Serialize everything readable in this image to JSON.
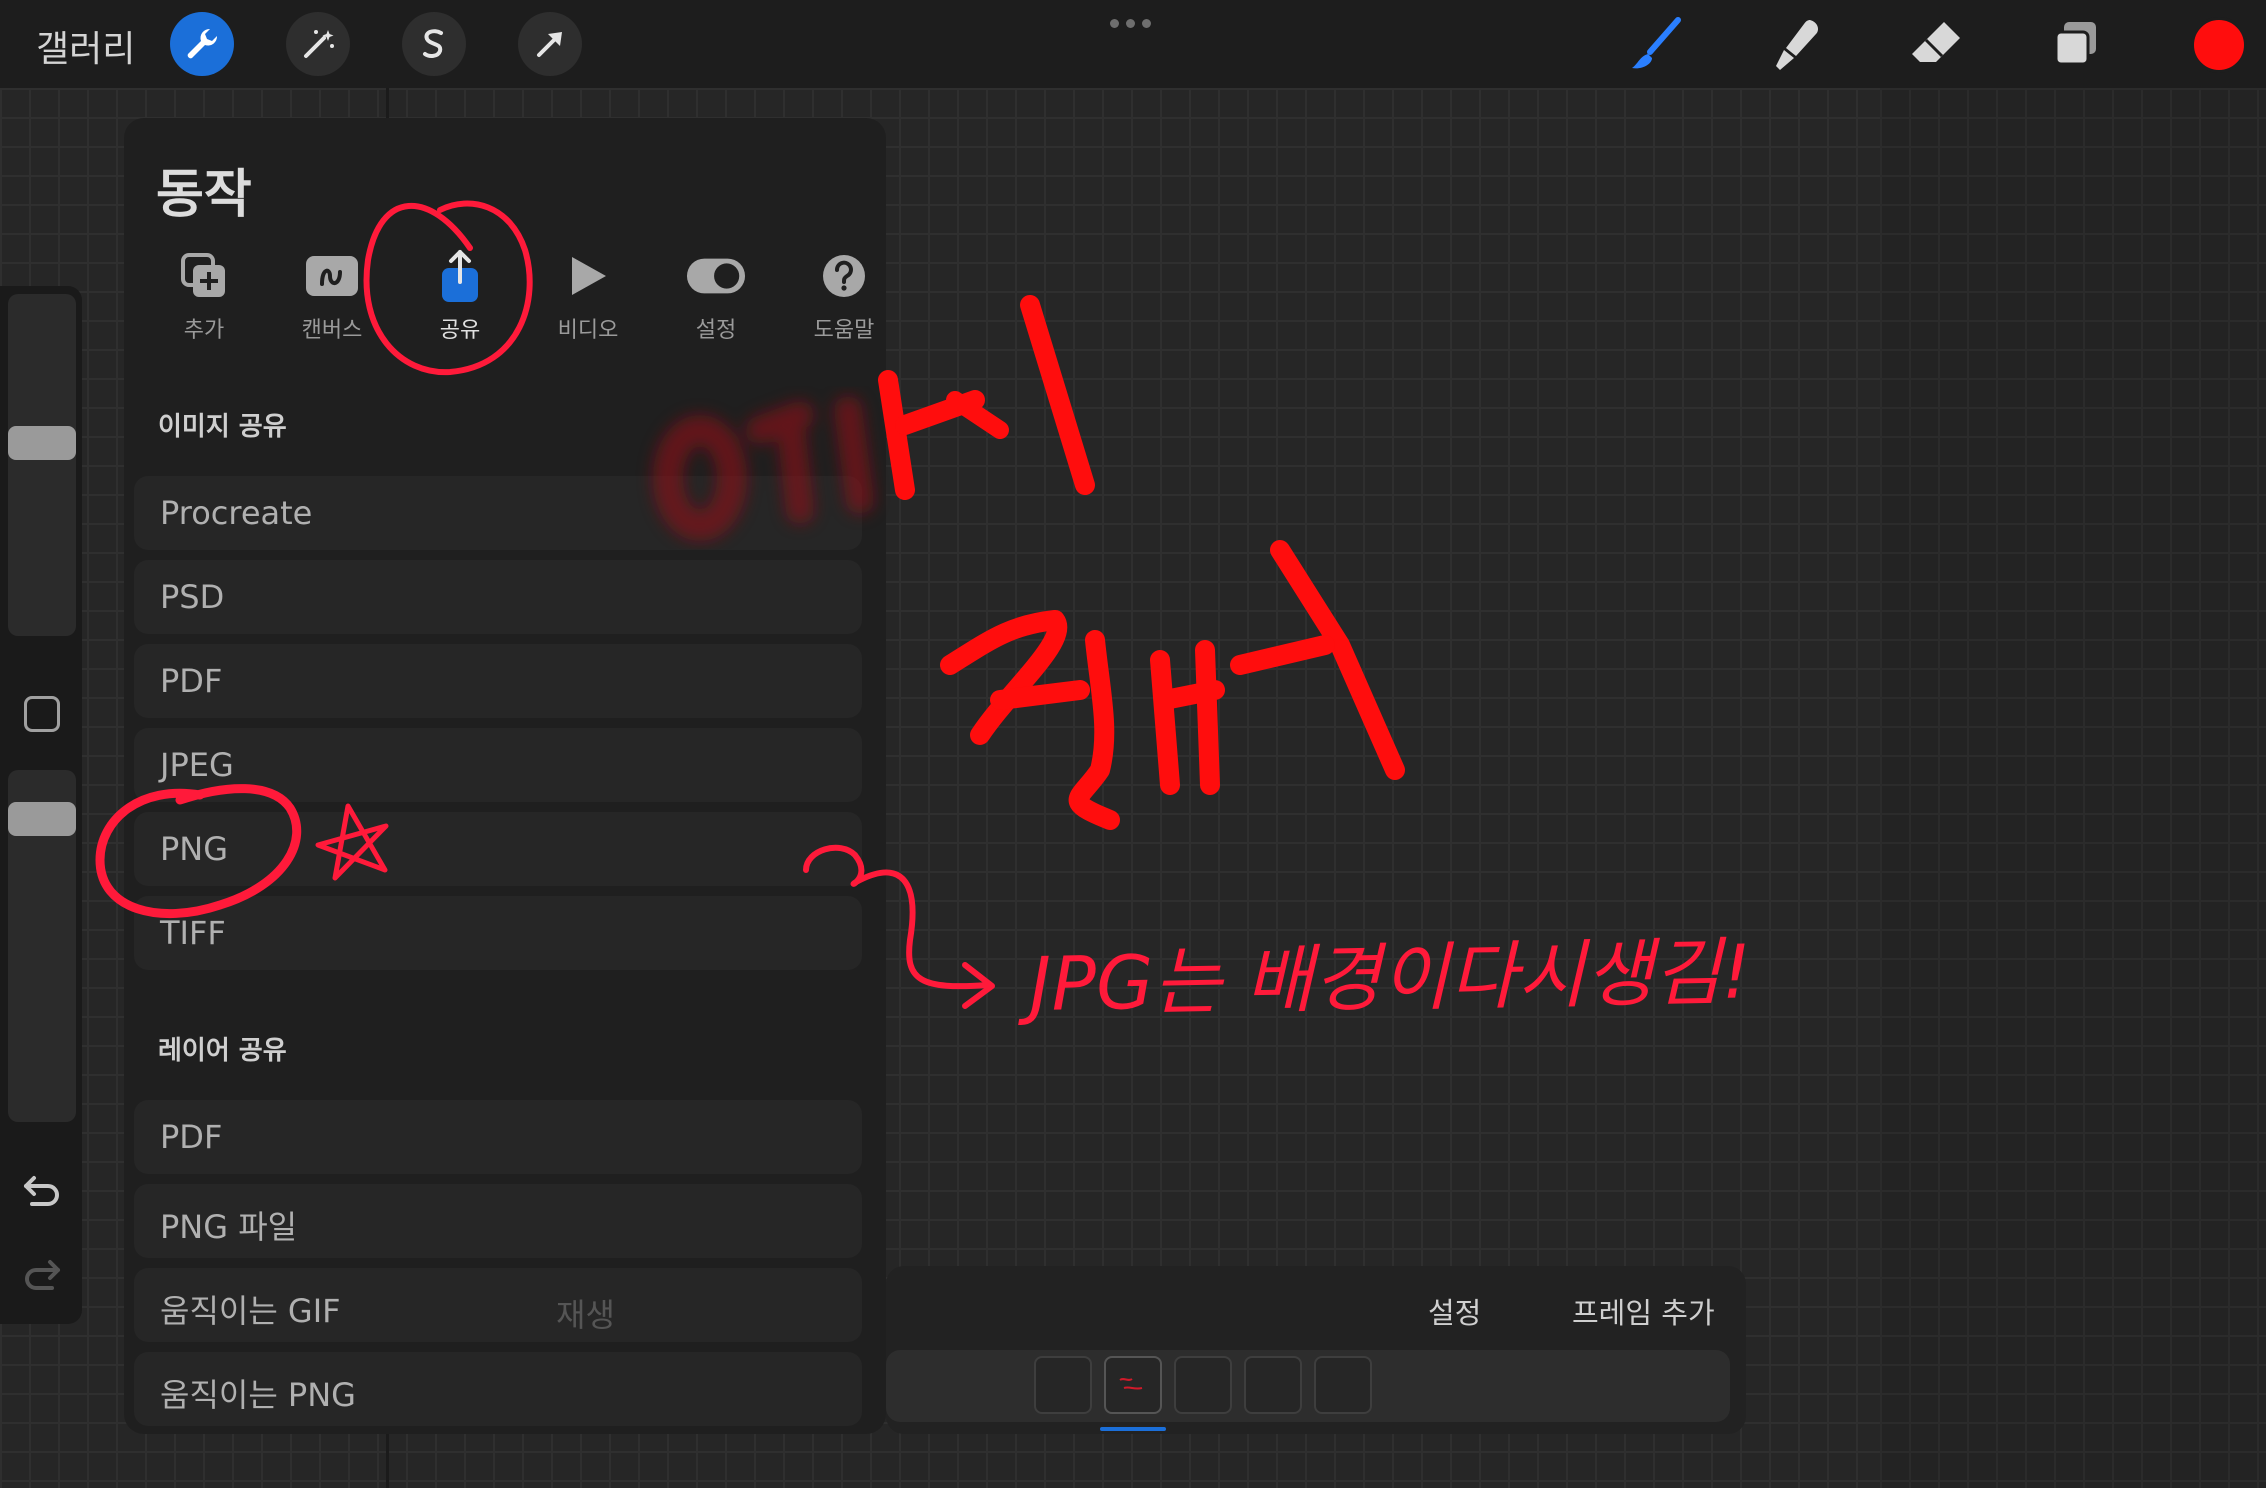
{
  "topbar": {
    "gallery_label": "갤러리",
    "current_color": "#ff0d0d",
    "accent_color": "#1b6fd9"
  },
  "actions_panel": {
    "title": "동작",
    "tabs": [
      {
        "label": "추가",
        "icon": "add-icon"
      },
      {
        "label": "캔버스",
        "icon": "canvas-icon"
      },
      {
        "label": "공유",
        "icon": "share-icon",
        "active": true
      },
      {
        "label": "비디오",
        "icon": "video-icon"
      },
      {
        "label": "설정",
        "icon": "toggle-icon"
      },
      {
        "label": "도움말",
        "icon": "help-icon"
      }
    ],
    "image_share_title": "이미지 공유",
    "image_formats": [
      "Procreate",
      "PSD",
      "PDF",
      "JPEG",
      "PNG",
      "TIFF"
    ],
    "layer_share_title": "레이어 공유",
    "layer_formats": [
      "PDF",
      "PNG 파일",
      "움직이는 GIF",
      "움직이는 PNG"
    ]
  },
  "animation_assist": {
    "play_label": "재생",
    "settings_label": "설정",
    "add_frame_label": "프레임 추가",
    "frame_count": 5,
    "selected_frame": 2
  },
  "annotations": {
    "handwritten_note": "JPG는 배경이다시생김!",
    "color": "#ff1a3a"
  }
}
